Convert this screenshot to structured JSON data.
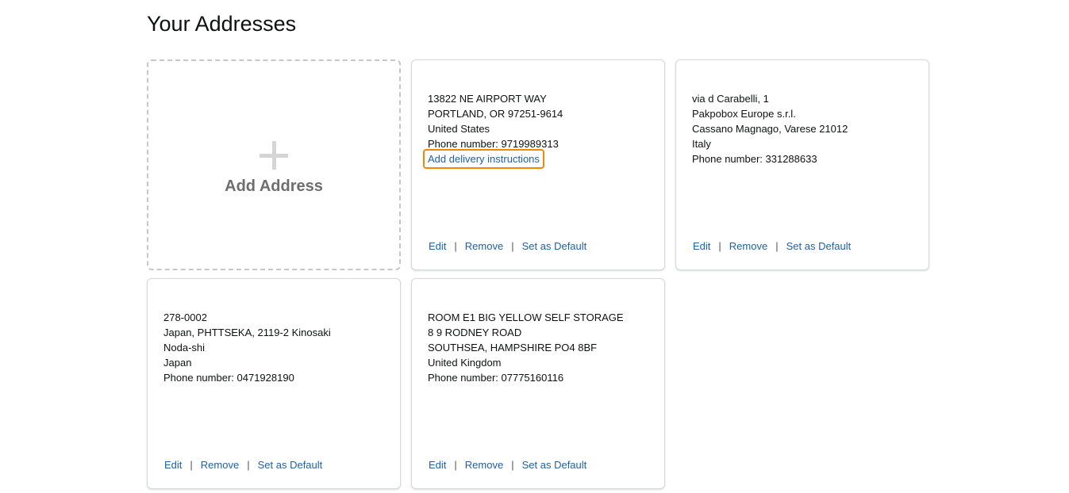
{
  "page": {
    "title": "Your Addresses"
  },
  "add_card": {
    "label": "Add Address",
    "icon": "plus-icon"
  },
  "actions": {
    "edit": "Edit",
    "remove": "Remove",
    "set_default": "Set as Default",
    "separator": "|"
  },
  "addresses": [
    {
      "lines": [
        "13822 NE AIRPORT WAY",
        "PORTLAND, OR 97251-9614",
        "United States",
        "Phone number: 9719989313"
      ],
      "delivery_link": "Add delivery instructions"
    },
    {
      "lines": [
        "via d Carabelli, 1",
        "Pakpobox Europe s.r.l.",
        "Cassano Magnago, Varese 21012",
        "Italy",
        "Phone number: 331288633"
      ]
    },
    {
      "lines": [
        "278-0002",
        "Japan, PHTTSEKA, 2119-2 Kinosaki",
        "Noda-shi",
        "Japan",
        "Phone number: 0471928190"
      ]
    },
    {
      "lines": [
        "ROOM E1 BIG YELLOW SELF STORAGE",
        "8 9 RODNEY ROAD",
        "SOUTHSEA, HAMPSHIRE PO4 8BF",
        "United Kingdom",
        "Phone number: 07775160116"
      ]
    }
  ],
  "colors": {
    "link": "#2162a1",
    "focus_outline": "#f08804",
    "card_border": "#d5d9d9",
    "dashed_border": "#c7c7c7",
    "add_label": "#6e6e6e"
  }
}
